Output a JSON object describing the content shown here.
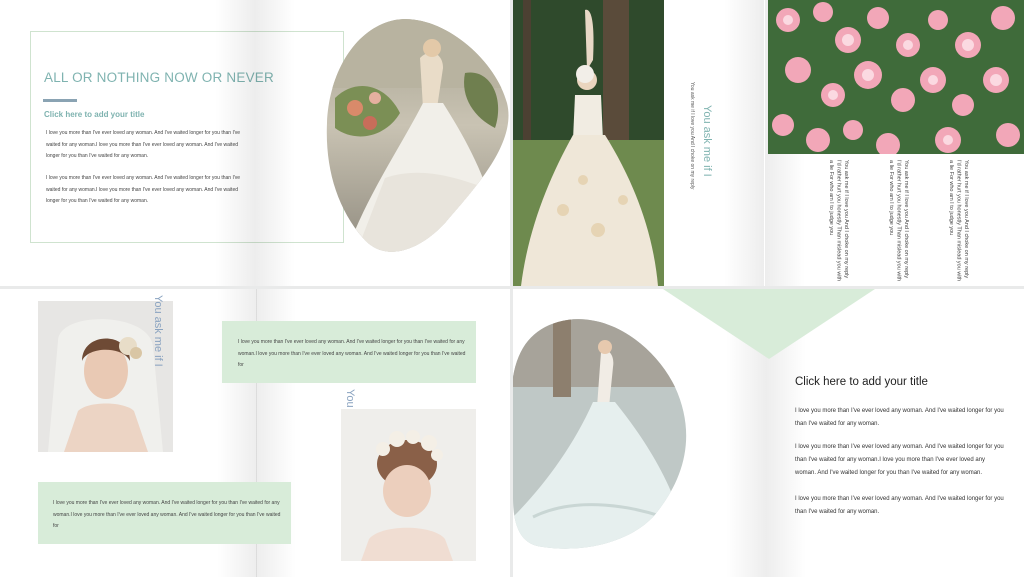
{
  "slide1": {
    "title": "ALL OR NOTHING NOW OR NEVER",
    "subtitle": "Click here to add your title",
    "paragraphs": [
      "I love you more than I've ever loved any woman. And I've waited longer for you than I've waited for any woman.I love you more than I've ever loved any woman. And I've waited longer for you than I've waited for any woman.",
      "I love you more than I've ever loved any woman. And I've waited longer for you than I've waited for any woman.I love you more than I've ever loved any woman. And I've waited longer for you than I've waited for any woman."
    ]
  },
  "slide2": {
    "heading": "You ask me if I",
    "subtext": "You ask me if I love you And I choke on my reply",
    "columns": [
      "You ask me if I love you And I choke on my reply I'd rather hurt you honestly Than mislead you with a lie For who am I to judge you",
      "You ask me if I love you And I choke on my reply I'd rather hurt you honestly Than mislead you with a lie For who am I to judge you",
      "You ask me if I love you And I choke on my reply I'd rather hurt you honestly Than mislead you with a lie For who am I to judge you"
    ]
  },
  "slide3": {
    "heading1": "You ask me if I",
    "heading2": "You ask me if I",
    "box1": "I love you more than I've ever loved any woman. And I've waited longer for you than I've waited for any woman.I love you more than I've ever loved any woman. And I've waited longer for you than I've waited for",
    "box2": "I love you more than I've ever loved any woman. And I've waited longer for you than I've waited for any woman.I love you more than I've ever loved any woman. And I've waited longer for you than I've waited for"
  },
  "slide4": {
    "title": "Click here to add your title",
    "paragraphs": [
      "I love you more than I've ever loved any woman. And I've waited longer for you than I've waited for any woman.",
      "I love you more than I've ever loved any woman. And I've waited longer for you than I've waited for any woman.I love you more than I've ever loved any woman. And I've waited longer for you than I've waited for any woman.",
      "I love you more than I've ever loved any woman. And I've waited longer for you than I've waited for any woman."
    ]
  },
  "colors": {
    "accent": "#7fb3b0",
    "green_box": "#d8ecd9",
    "divider": "#8aa3b3",
    "vertical_text": "#8aa3c0"
  },
  "images": [
    "bride-flowers-photo",
    "bride-forest-photo",
    "pink-roses-photo",
    "bride-veil-portrait-photo",
    "bride-flower-crown-photo",
    "bride-gown-train-photo"
  ]
}
